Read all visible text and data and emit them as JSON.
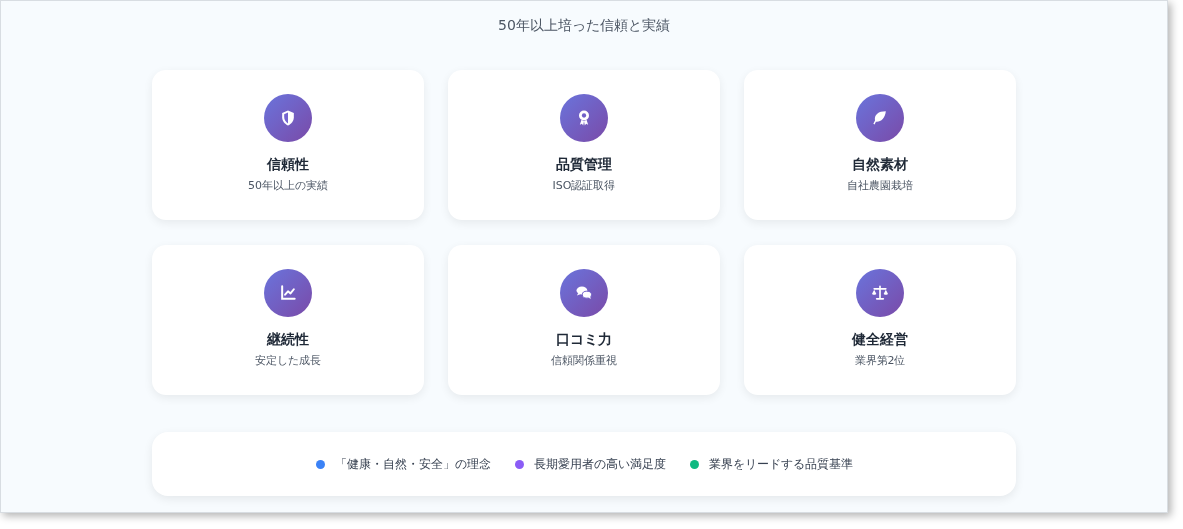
{
  "title": "50年以上培った信頼と実績",
  "cards": [
    {
      "title": "信頼性",
      "subtitle": "50年以上の実績"
    },
    {
      "title": "品質管理",
      "subtitle": "ISO認証取得"
    },
    {
      "title": "自然素材",
      "subtitle": "自社農園栽培"
    },
    {
      "title": "継続性",
      "subtitle": "安定した成長"
    },
    {
      "title": "口コミ力",
      "subtitle": "信頼関係重視"
    },
    {
      "title": "健全経営",
      "subtitle": "業界第2位"
    }
  ],
  "legend": [
    {
      "label": "「健康・自然・安全」の理念",
      "color": "#3b82f6"
    },
    {
      "label": "長期愛用者の高い満足度",
      "color": "#8b5cf6"
    },
    {
      "label": "業界をリードする品質基準",
      "color": "#10b981"
    }
  ]
}
